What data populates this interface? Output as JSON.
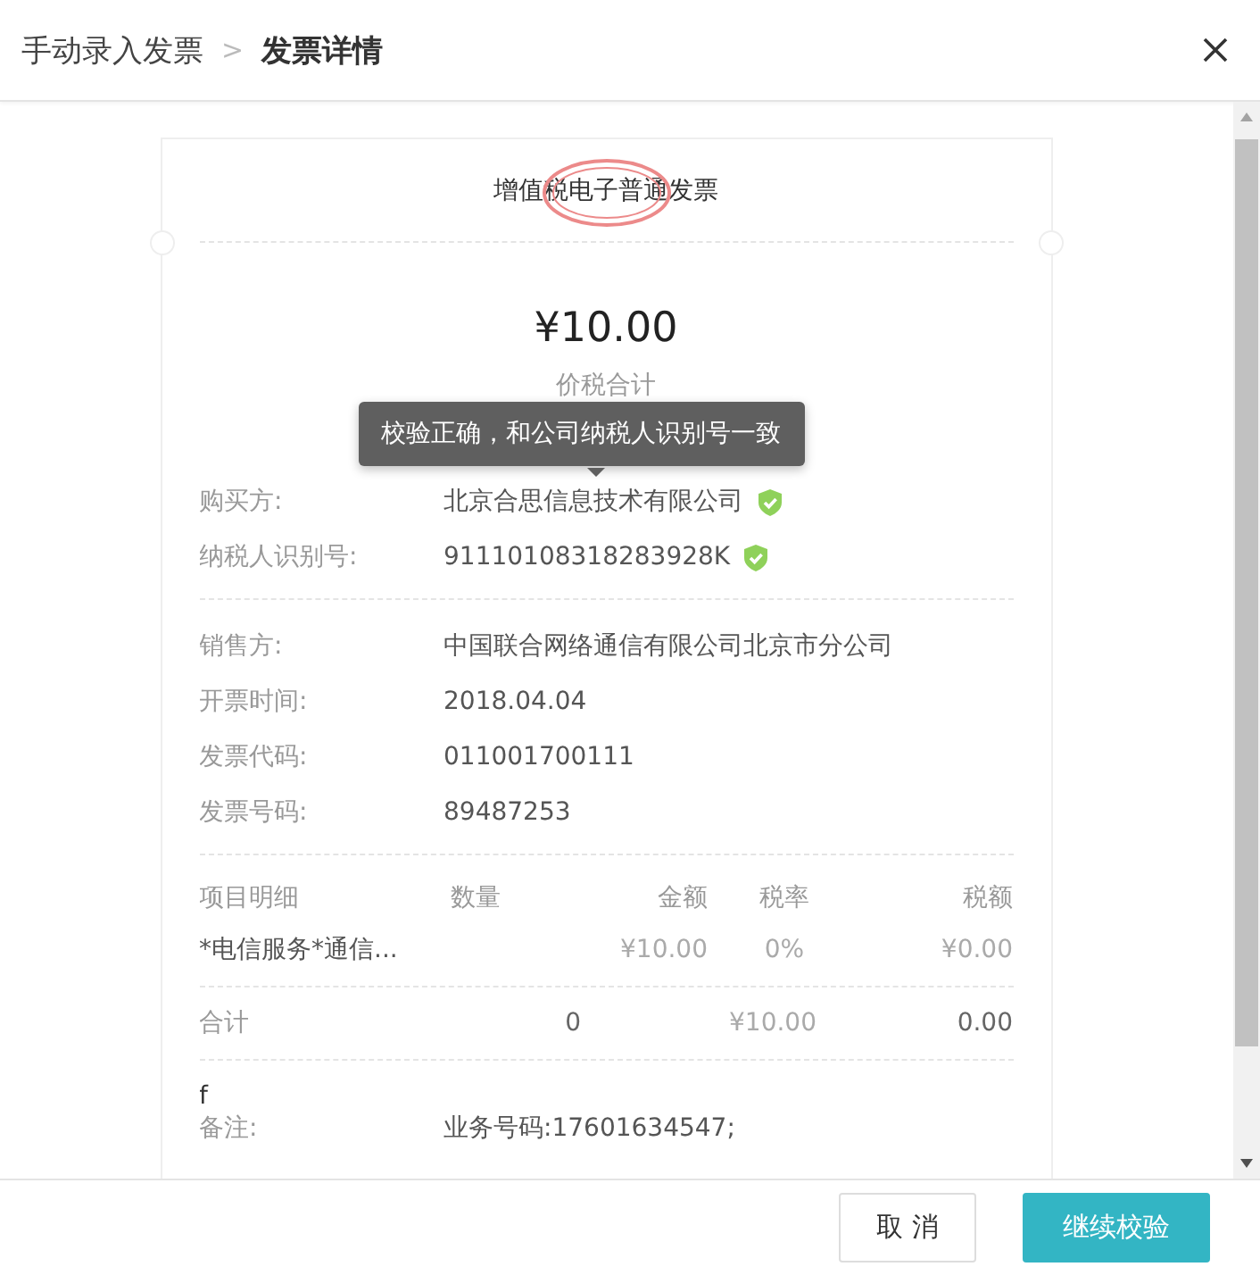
{
  "header": {
    "breadcrumb": [
      {
        "label": "手动录入发票",
        "current": false
      },
      {
        "label": "发票详情",
        "current": true
      }
    ],
    "separator": ">"
  },
  "invoice": {
    "title": "增值税电子普通发票",
    "amount": "¥10.00",
    "amount_label": "价税合计",
    "tooltip": "校验正确，和公司纳税人识别号一致",
    "sections": [
      [
        {
          "label": "购买方:",
          "value": "北京合思信息技术有限公司",
          "verified": true
        },
        {
          "label": "纳税人识别号:",
          "value": "91110108318283928K",
          "verified": true
        }
      ],
      [
        {
          "label": "销售方:",
          "value": "中国联合网络通信有限公司北京市分公司",
          "verified": false
        },
        {
          "label": "开票时间:",
          "value": "2018.04.04",
          "verified": false
        },
        {
          "label": "发票代码:",
          "value": "011001700111",
          "verified": false
        },
        {
          "label": "发票号码:",
          "value": "89487253",
          "verified": false
        }
      ]
    ],
    "table": {
      "columns": [
        "项目明细",
        "数量",
        "金额",
        "税率",
        "税额"
      ],
      "rows": [
        [
          "*电信服务*通信...",
          "",
          "¥10.00",
          "0%",
          "¥0.00"
        ]
      ],
      "total": {
        "label": "合计",
        "quantity": "0",
        "amount": "¥10.00",
        "tax": "0.00"
      }
    },
    "remark_mark": "f",
    "remark": {
      "label": "备注:",
      "value": "业务号码:17601634547;"
    }
  },
  "buttons": [
    {
      "label": "取 消",
      "kind": "secondary"
    },
    {
      "label": "继续校验",
      "kind": "primary"
    }
  ]
}
